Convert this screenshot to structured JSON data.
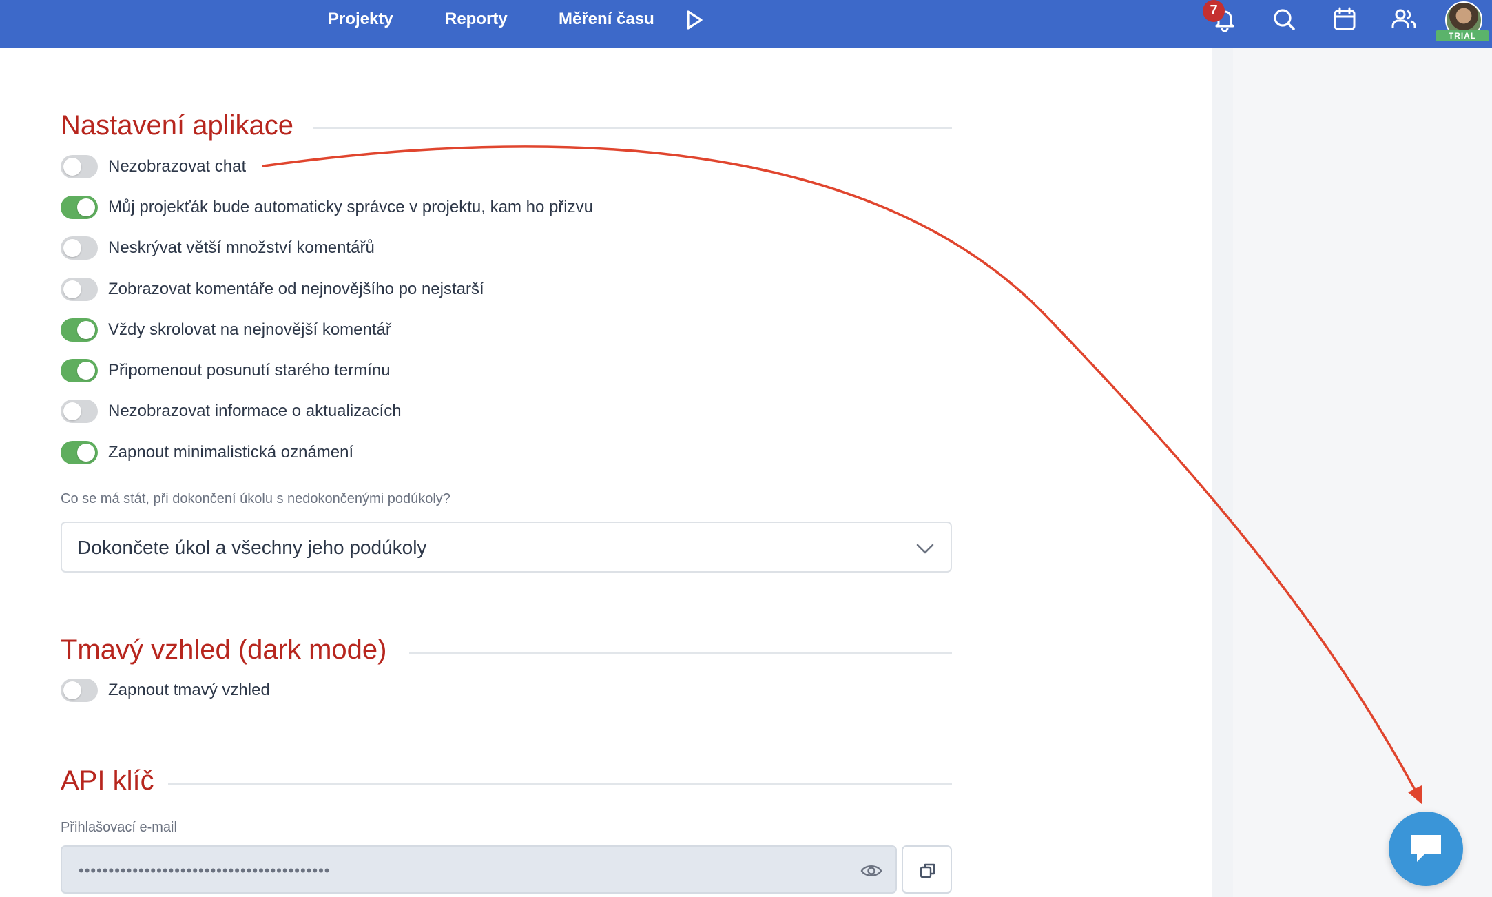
{
  "nav": {
    "projects": "Projekty",
    "reports": "Reporty",
    "time_tracking": "Měření času",
    "notifications_count": "7",
    "trial_label": "TRIAL",
    "icons": [
      "play-icon",
      "bell-icon",
      "search-icon",
      "calendar-icon",
      "users-icon"
    ]
  },
  "app_settings": {
    "title": "Nastavení aplikace",
    "toggles": [
      {
        "label": "Nezobrazovat chat",
        "on": false
      },
      {
        "label": "Můj projekťák bude automaticky správce v projektu, kam ho přizvu",
        "on": true
      },
      {
        "label": "Neskrývat větší množství komentářů",
        "on": false
      },
      {
        "label": "Zobrazovat komentáře od nejnovějšího po nejstarší",
        "on": false
      },
      {
        "label": "Vždy skrolovat na nejnovější komentář",
        "on": true
      },
      {
        "label": "Připomenout posunutí starého termínu",
        "on": true
      },
      {
        "label": "Nezobrazovat informace o aktualizacích",
        "on": false
      },
      {
        "label": "Zapnout minimalistická oznámení",
        "on": true
      }
    ],
    "subtask_question": "Co se má stát, při dokončení úkolu s nedokončenými podúkoly?",
    "subtask_selected": "Dokončete úkol a všechny jeho podúkoly"
  },
  "dark_mode": {
    "title": "Tmavý vzhled (dark mode)",
    "toggle": {
      "label": "Zapnout tmavý vzhled",
      "on": false
    }
  },
  "api_key": {
    "title": "API klíč",
    "email_label": "Přihlašovací e-mail",
    "email_masked": "••••••••••••••••••••••••••••••••••••••••••"
  },
  "colors": {
    "header": "#3d69c9",
    "section_title": "#b7261e",
    "toggle_on": "#5fae5e",
    "toggle_off": "#d5d7da",
    "chat_button": "#3a95d8",
    "annotation_arrow": "#e0452e"
  }
}
